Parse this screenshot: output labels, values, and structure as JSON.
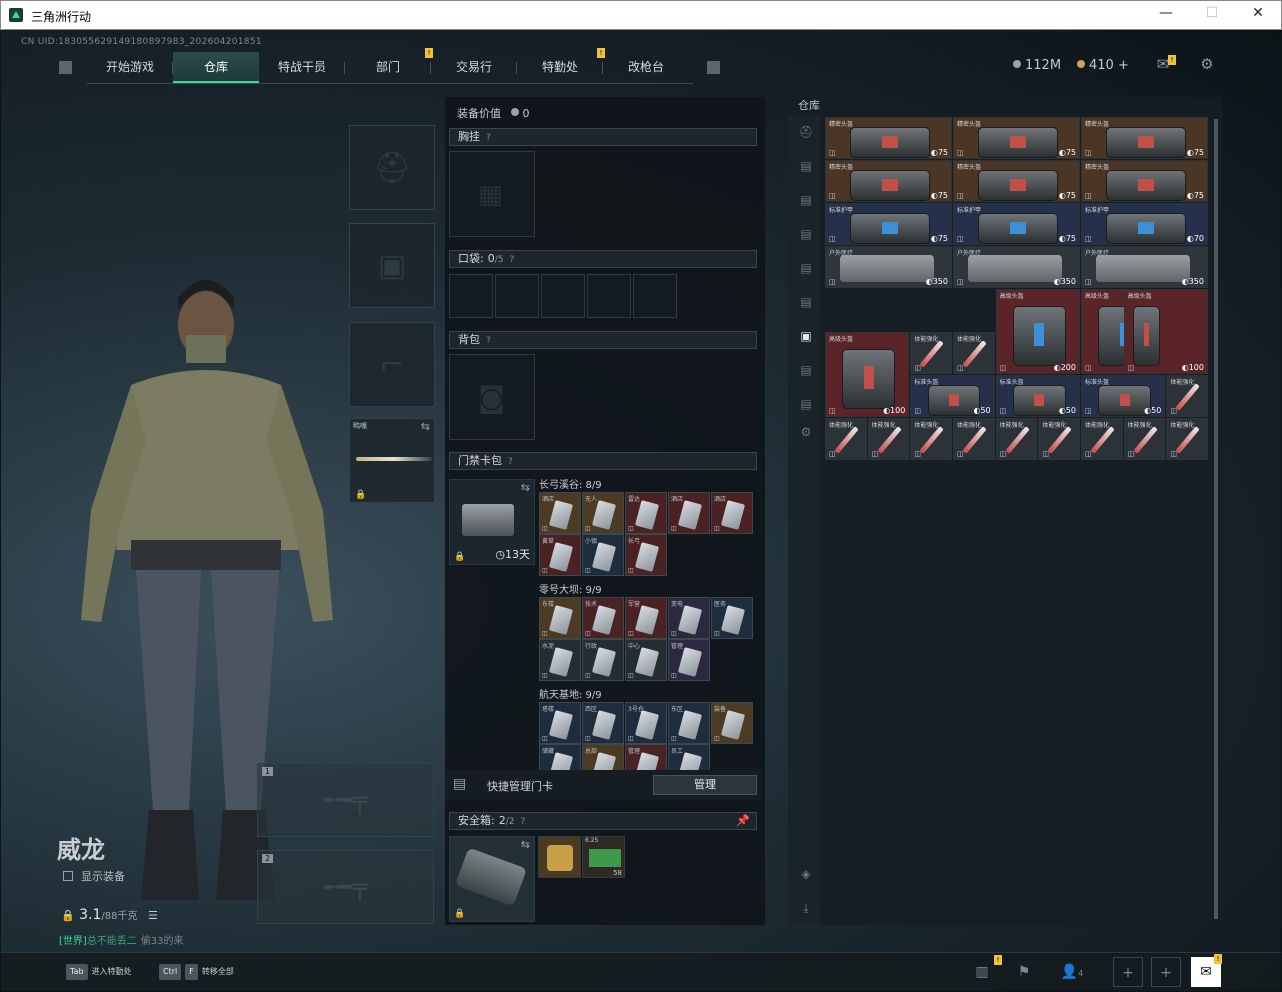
{
  "window": {
    "title": "三角洲行动",
    "controls": [
      "—",
      "☐",
      "✕"
    ]
  },
  "uid": "CN UID:1830556291491808979​83_202604201851",
  "nav": {
    "tabs": [
      "开始游戏",
      "仓库",
      "特战干员",
      "部门",
      "交易行",
      "特勤处",
      "改枪台"
    ],
    "active": 1,
    "badges": [
      "!",
      "!"
    ]
  },
  "currency": {
    "money": "112M",
    "coins": "410 +"
  },
  "operator": {
    "name": "威龙",
    "show_equip": "显示装备",
    "weight": "3.1",
    "weight_max": "/88千克",
    "chat_channel": "[世界]",
    "chat_name": "总不能丢二",
    "chat_msg": "偷33的来"
  },
  "loadout": {
    "melee_label": "鸭嘴",
    "weapon_slots": [
      "1",
      "2"
    ]
  },
  "equip": {
    "value_label": "装备价值",
    "value": "0",
    "rig": "胸挂",
    "pockets": "口袋:",
    "pockets_count": "0",
    "pockets_max": "/5",
    "backpack": "背包",
    "keycard": "门禁卡包",
    "keycard_time": "13天",
    "groups": [
      {
        "label": "长弓溪谷: 8/9",
        "cards": [
          [
            "酒店",
            "c-gold"
          ],
          [
            "无人",
            "c-gold"
          ],
          [
            "雷达",
            "c-red"
          ],
          [
            "酒店",
            "c-red"
          ],
          [
            "酒店",
            "c-red"
          ],
          [
            "黄草",
            "c-red"
          ],
          [
            "小镇",
            "c-blue"
          ],
          [
            "长弓",
            "c-red"
          ]
        ]
      },
      {
        "label": "零号大坝: 9/9",
        "cards": [
          [
            "东楼",
            "c-gold"
          ],
          [
            "技术",
            "c-red"
          ],
          [
            "军营",
            "c-red"
          ],
          [
            "变电",
            "c-purp"
          ],
          [
            "医务",
            "c-blue"
          ],
          [
            "水泥",
            "c-gray"
          ],
          [
            "行政",
            "c-gray"
          ],
          [
            "中心",
            "c-gray"
          ],
          [
            "管理",
            "c-purp"
          ]
        ]
      },
      {
        "label": "航天基地: 9/9",
        "cards": [
          [
            "塔楼",
            "c-blue"
          ],
          [
            "西区",
            "c-blue"
          ],
          [
            "3号仓",
            "c-blue"
          ],
          [
            "东区",
            "c-blue"
          ],
          [
            "装备",
            "c-gold"
          ],
          [
            "储藏",
            "c-blue"
          ],
          [
            "总部",
            "c-gold"
          ],
          [
            "管理",
            "c-red"
          ],
          [
            "员工",
            "c-blue"
          ]
        ]
      }
    ],
    "manage_label": "快捷管理门卡",
    "manage_btn": "管理",
    "safebox": "安全箱:",
    "safebox_count": "2",
    "safebox_max": "/2",
    "safe_item_count": "58",
    "safe_item_label": "6.25"
  },
  "stash": {
    "title": "仓库",
    "items": [
      {
        "name": "精密头盔",
        "v": "75",
        "c": "#4b3525"
      },
      {
        "name": "精密头盔",
        "v": "75",
        "c": "#4b3525"
      },
      {
        "name": "精密头盔",
        "v": "75",
        "c": "#4b3525"
      },
      {
        "name": "精密头盔",
        "v": "75",
        "c": "#4b3525"
      },
      {
        "name": "精密头盔",
        "v": "75",
        "c": "#4b3525"
      },
      {
        "name": "精密头盔",
        "v": "75",
        "c": "#4b3525"
      },
      {
        "name": "标准护甲",
        "v": "75",
        "c": "#26304a"
      },
      {
        "name": "标准护甲",
        "v": "75",
        "c": "#26304a"
      },
      {
        "name": "标准护甲",
        "v": "70",
        "c": "#26304a"
      },
      {
        "name": "户外医疗",
        "v": "350",
        "c": "#2e363b"
      },
      {
        "name": "户外医疗",
        "v": "350",
        "c": "#2e363b"
      },
      {
        "name": "户外医疗",
        "v": "350",
        "c": "#2e363b"
      },
      {
        "name": "高级头盔",
        "v": "200",
        "c": "#5a2428"
      },
      {
        "name": "高级头盔",
        "v": "200",
        "c": "#5a2428"
      },
      {
        "name": "高级头盔",
        "v": "100",
        "c": "#5a2428"
      },
      {
        "name": "高级头盔",
        "v": "100",
        "c": "#5a2428"
      },
      {
        "name": "标准头盔",
        "v": "50",
        "c": "#26304a"
      },
      {
        "name": "标准头盔",
        "v": "50",
        "c": "#26304a"
      },
      {
        "name": "标准头盔",
        "v": "50",
        "c": "#26304a"
      },
      {
        "name": "体能强化",
        "v": "",
        "c": "#2b3238"
      }
    ]
  },
  "bottom": {
    "key1": "Tab",
    "key1_label": "进入特勤处",
    "key2a": "Ctrl",
    "key2b": "F",
    "key2_label": "转移全部",
    "friends": "4",
    "badges": [
      "!",
      "!"
    ]
  }
}
